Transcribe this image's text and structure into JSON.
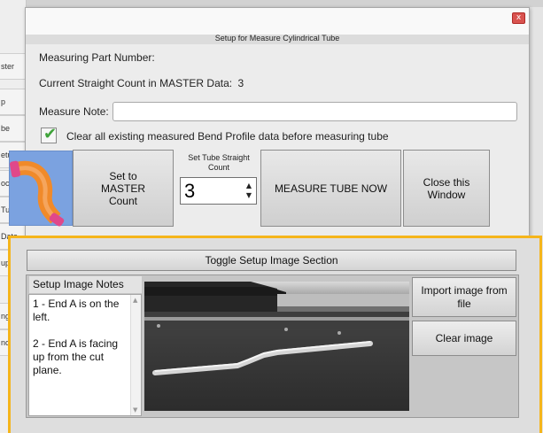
{
  "background": {
    "sidebar_tabs": [
      "ster",
      "p",
      "be",
      "etup",
      "oces",
      "Tube",
      "Data",
      "up",
      "ng",
      "nce"
    ]
  },
  "dialog": {
    "title": "Setup for Measure Cylindrical Tube",
    "close_glyph": "x",
    "part_number_label": "Measuring Part Number:",
    "straight_count_label": "Current Straight Count in MASTER Data:",
    "straight_count_value": "3",
    "measure_note_label": "Measure Note:",
    "measure_note_value": "",
    "clear_checkbox_label": "Clear all existing measured Bend Profile data before measuring tube",
    "clear_checkbox_checked": true,
    "set_master_label": "Set to\nMASTER\nCount",
    "stepper_label": "Set Tube Straight Count",
    "stepper_value": "3",
    "measure_now_label": "MEASURE TUBE NOW",
    "close_window_label": "Close this Window"
  },
  "setup_image": {
    "toggle_label": "Toggle Setup Image Section",
    "notes_header": "Setup Image Notes",
    "notes_text": "1 - End A is on the left.\n\n2 - End A is facing up from the cut plane.",
    "import_label": "Import image from file",
    "clear_label": "Clear image"
  },
  "colors": {
    "highlight": "#f5b51b",
    "close_button": "#d9534f",
    "tube_bg": "#7ba2e0",
    "tube_orange": "#f08a2a",
    "tube_pink": "#e0488a",
    "check_green": "#3fa33a"
  },
  "icons": {
    "checkbox": "check-icon",
    "tube_preview": "bent-tube-icon",
    "stepper_up": "caret-up-icon",
    "stepper_down": "caret-down-icon"
  }
}
